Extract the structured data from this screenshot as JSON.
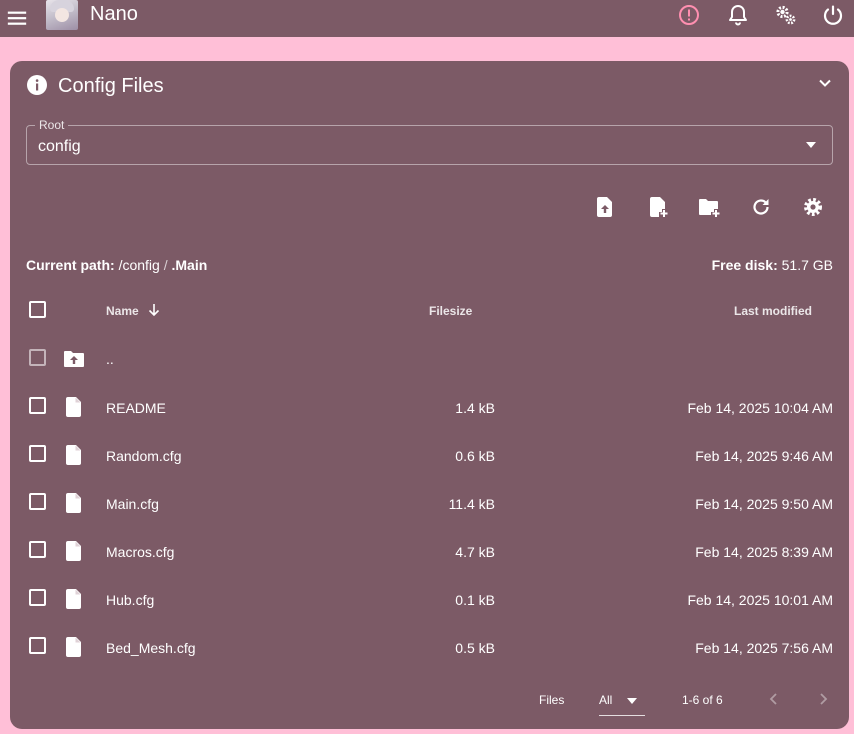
{
  "app": {
    "title": "Nano"
  },
  "colors": {
    "background": "#ffbfd7",
    "surface": "#7c5a66",
    "alert": "#ff8fb0"
  },
  "topbar_icons": [
    "menu-icon",
    "alert-icon",
    "bell-icon",
    "gears-icon",
    "power-icon"
  ],
  "card": {
    "title": "Config Files",
    "root_label": "Root",
    "root_value": "config",
    "toolbar_icons": [
      "upload-file-icon",
      "new-file-icon",
      "new-folder-icon",
      "refresh-icon",
      "settings-icon"
    ],
    "path": {
      "label": "Current path:",
      "base": "/config",
      "separator": "/",
      "current": ".Main"
    },
    "free_disk": {
      "label": "Free disk:",
      "value": "51.7 GB"
    },
    "columns": {
      "name": "Name",
      "filesize": "Filesize",
      "modified": "Last modified"
    },
    "parent_row": {
      "name": ".."
    },
    "files": [
      {
        "name": "README",
        "size": "1.4 kB",
        "modified": "Feb 14, 2025 10:04 AM"
      },
      {
        "name": "Random.cfg",
        "size": "0.6 kB",
        "modified": "Feb 14, 2025 9:46 AM"
      },
      {
        "name": "Main.cfg",
        "size": "11.4 kB",
        "modified": "Feb 14, 2025 9:50 AM"
      },
      {
        "name": "Macros.cfg",
        "size": "4.7 kB",
        "modified": "Feb 14, 2025 8:39 AM"
      },
      {
        "name": "Hub.cfg",
        "size": "0.1 kB",
        "modified": "Feb 14, 2025 10:01 AM"
      },
      {
        "name": "Bed_Mesh.cfg",
        "size": "0.5 kB",
        "modified": "Feb 14, 2025 7:56 AM"
      }
    ],
    "footer": {
      "files_label": "Files",
      "per_page": "All",
      "range": "1-6 of 6"
    }
  }
}
